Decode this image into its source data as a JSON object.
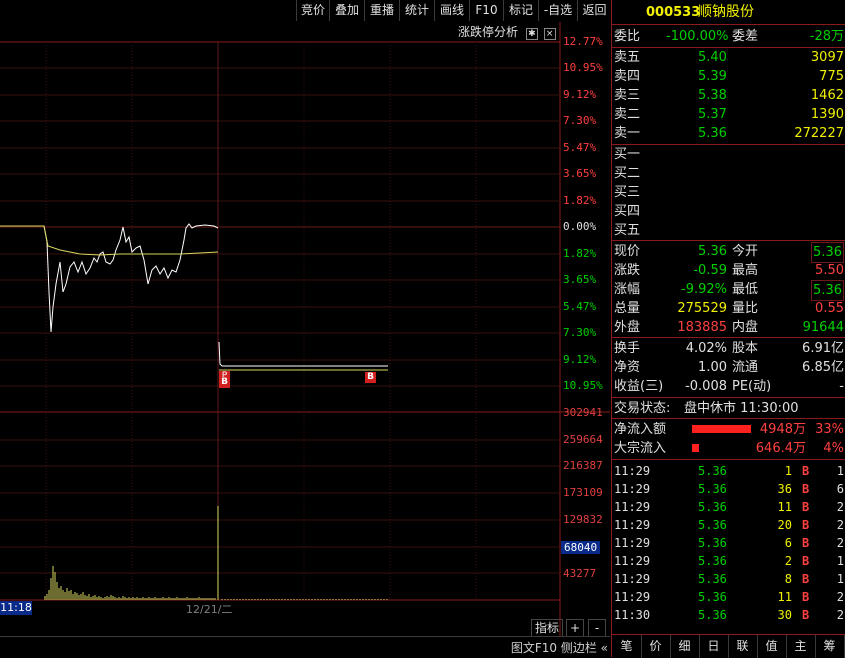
{
  "toolbar": {
    "buttons": [
      "竞价",
      "叠加",
      "重播",
      "统计",
      "画线",
      "F10",
      "标记",
      "-自选",
      "返回"
    ]
  },
  "chart": {
    "analysis_label": "涨跌停分析",
    "pct_up": [
      "12.77%",
      "10.95%",
      "9.12%",
      "7.30%",
      "5.47%",
      "3.65%",
      "1.82%"
    ],
    "pct_zero": "0.00%",
    "pct_down": [
      "1.82%",
      "3.65%",
      "5.47%",
      "7.30%",
      "9.12%",
      "10.95%"
    ],
    "vol_ticks": [
      "302941",
      "259664",
      "216387",
      "173109",
      "129832",
      "68040",
      "43277"
    ],
    "time_start": "11:18",
    "date_label": "12/21/二",
    "marker_b": "B",
    "marker_p": "P",
    "bottom_controls": [
      "指标",
      "+",
      "-"
    ],
    "status_bar": "图文F10 侧边栏 «"
  },
  "stock": {
    "code": "000533",
    "name": "顺钠股份",
    "weibi_label": "委比",
    "weibi_value": "-100.00%",
    "weicha_label": "委差",
    "weicha_value": "-28万"
  },
  "asks": [
    {
      "label": "卖五",
      "price": "5.40",
      "vol": "3097"
    },
    {
      "label": "卖四",
      "price": "5.39",
      "vol": "775"
    },
    {
      "label": "卖三",
      "price": "5.38",
      "vol": "1462"
    },
    {
      "label": "卖二",
      "price": "5.37",
      "vol": "1390"
    },
    {
      "label": "卖一",
      "price": "5.36",
      "vol": "272227"
    }
  ],
  "bids": [
    {
      "label": "买一"
    },
    {
      "label": "买二"
    },
    {
      "label": "买三"
    },
    {
      "label": "买四"
    },
    {
      "label": "买五"
    }
  ],
  "quote": [
    {
      "l1": "现价",
      "v1": "5.36",
      "l2": "今开",
      "v2": "5.36"
    },
    {
      "l1": "涨跌",
      "v1": "-0.59",
      "l2": "最高",
      "v2": "5.50"
    },
    {
      "l1": "涨幅",
      "v1": "-9.92%",
      "l2": "最低",
      "v2": "5.36"
    },
    {
      "l1": "总量",
      "v1": "275529",
      "l2": "量比",
      "v2": "0.55"
    },
    {
      "l1": "外盘",
      "v1": "183885",
      "l2": "内盘",
      "v2": "91644"
    }
  ],
  "stats": [
    {
      "l1": "换手",
      "v1": "4.02%",
      "l2": "股本",
      "v2": "6.91亿"
    },
    {
      "l1": "净资",
      "v1": "1.00",
      "l2": "流通",
      "v2": "6.85亿"
    },
    {
      "l1": "收益(三)",
      "v1": "-0.008",
      "l2": "PE(动)",
      "v2": "-"
    }
  ],
  "status": {
    "label": "交易状态:",
    "value": "盘中休市 11:30:00"
  },
  "flows": [
    {
      "label": "净流入额",
      "value": "4948万",
      "pct": "33%",
      "ratio": 0.33
    },
    {
      "label": "大宗流入",
      "value": "646.4万",
      "pct": "4%",
      "ratio": 0.04
    }
  ],
  "ticks": [
    {
      "time": "11:29",
      "price": "5.36",
      "vol": "1",
      "side": "B",
      "n": "1"
    },
    {
      "time": "11:29",
      "price": "5.36",
      "vol": "36",
      "side": "B",
      "n": "6"
    },
    {
      "time": "11:29",
      "price": "5.36",
      "vol": "11",
      "side": "B",
      "n": "2"
    },
    {
      "time": "11:29",
      "price": "5.36",
      "vol": "20",
      "side": "B",
      "n": "2"
    },
    {
      "time": "11:29",
      "price": "5.36",
      "vol": "6",
      "side": "B",
      "n": "2"
    },
    {
      "time": "11:29",
      "price": "5.36",
      "vol": "2",
      "side": "B",
      "n": "1"
    },
    {
      "time": "11:29",
      "price": "5.36",
      "vol": "8",
      "side": "B",
      "n": "1"
    },
    {
      "time": "11:29",
      "price": "5.36",
      "vol": "11",
      "side": "B",
      "n": "2"
    },
    {
      "time": "11:30",
      "price": "5.36",
      "vol": "30",
      "side": "B",
      "n": "2"
    }
  ],
  "tabs": [
    "笔",
    "价",
    "细",
    "日",
    "联",
    "值",
    "主",
    "筹"
  ]
}
